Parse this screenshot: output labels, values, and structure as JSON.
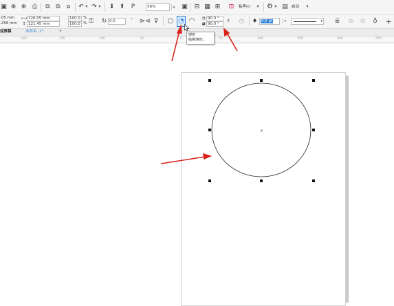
{
  "toolbar_top": {
    "zoom_value": "58%",
    "paste_menu_label": "粘声(I)",
    "launch_label": "启动"
  },
  "property_bar": {
    "x_value": ".05 mm",
    "y_value": ".256 mm",
    "width_value": "126.05 mm",
    "height_value": "121.45 mm",
    "scale_w": "100.0",
    "scale_h": "100.0",
    "percent_sign": "%",
    "rotation_value": "0.0",
    "degree_sign": "°",
    "start_angle": "90.0 °",
    "end_angle": "90.0 °",
    "outline_width": "0.5 pt"
  },
  "tabs": {
    "welcome_tab": "迎屏幕",
    "document_tab": "未命名 -1*",
    "add_tab": "+"
  },
  "ruler": {
    "ticks": [
      "200",
      "150",
      "100",
      "50",
      "0",
      "50",
      "100",
      "150",
      "200",
      "250"
    ]
  },
  "tooltip": {
    "title": "饼形",
    "description": "绘制饼形。"
  },
  "colors": {
    "arrow_red": "#d9231d",
    "highlight_blue": "#2f7fd8",
    "selection_handle": "#111111"
  }
}
